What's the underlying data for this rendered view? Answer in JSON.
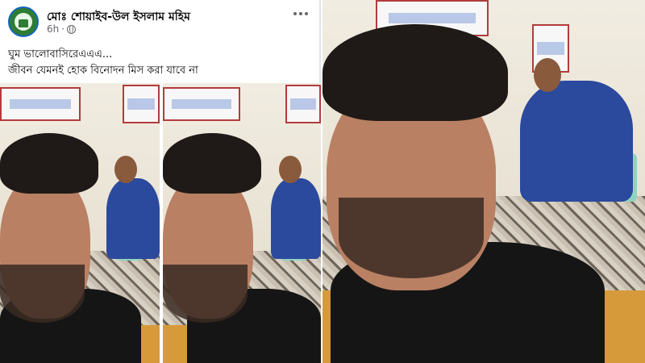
{
  "post": {
    "author": "মোঃ শোয়াইব-উল ইসলাম মহিম",
    "time": "6h",
    "separator": "·",
    "text_lines": [
      "ঘুম ভালোবাসিরেএএএ...",
      "জীবন যেমনই হোক বিনোদন মিস করা যাবে না"
    ]
  },
  "colors": {
    "author_text": "#050505",
    "meta_text": "#65676b",
    "divider": "#dfe3e8"
  },
  "icons": {
    "privacy": "globe-icon",
    "menu": "more-options-icon"
  }
}
